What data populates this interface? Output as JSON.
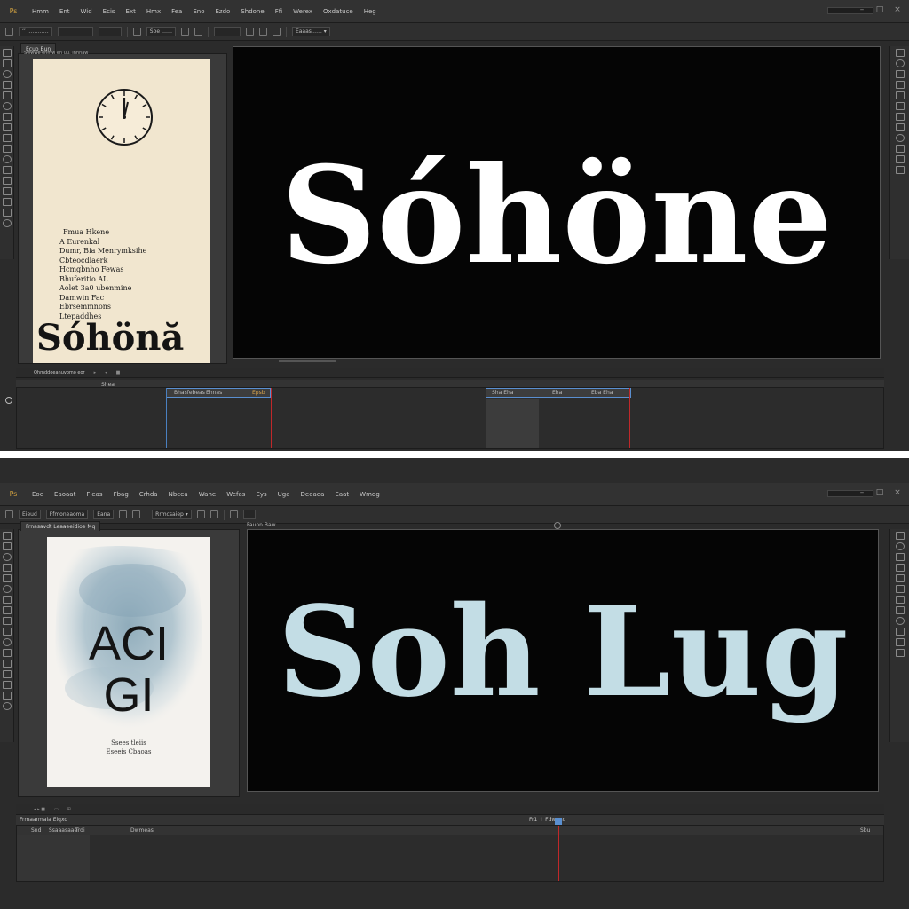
{
  "top": {
    "menu": [
      "Hmm",
      "Ent",
      "Wid",
      "Ecis",
      "Ext",
      "Hmx",
      "Fea",
      "Eno",
      "Ezdo",
      "Shdone",
      "Ffi",
      "Werex",
      "Oxdatuce",
      "Heg"
    ],
    "options": {
      "field1": "‘’ …………",
      "field2": "Sbe ……",
      "dropdown": "Eaaas…… ▾"
    },
    "panel_tab": "Ecuo Bun",
    "panel_subtitle": "Swwwe enmw en uu. Ihhnaw",
    "poster_lines": [
      "Fmua Hkene",
      "A Eurenkal",
      "Dumr, Bia Menrymksihe",
      "Cbteocdlaerk",
      "Hcmgbnho Fewas",
      "Bhuferitio AL",
      "Aolet 3a0 ubenmine",
      "Damwin Fac",
      "Ebrsemmnons",
      "Ltepaddhes"
    ],
    "poster_title": "Sóhönă",
    "viewer_title": "Sóhöne",
    "timeline_tab": "Qhmddoeanuvomo eor",
    "timeline_label": "Shea",
    "clip_labels": [
      "Bhasfebeas",
      "Ehnas",
      "Epsb",
      "Sha Eha",
      "Eha",
      "Eba Eha"
    ]
  },
  "bottom": {
    "menu": [
      "Eoe",
      "Eaoaat",
      "Fleas",
      "Fbag",
      "Crhda",
      "Nbcea",
      "Wane",
      "Wefas",
      "Eys",
      "Uga",
      "Deeaea",
      "Eaat",
      "Wmqg"
    ],
    "options": {
      "field1": "Eieud",
      "field2": "Ffmoneaoma",
      "field3": "Eana",
      "dropdown": "Rrmcsaiep ▾"
    },
    "panel_tab": "Frnasavdt Leaaeeidioe Mq",
    "viewer_tab": "Faunn Baw",
    "poster_title_line1": "ACI",
    "poster_title_line2": "GI",
    "poster_caption_line1": "Ssees tleiis",
    "poster_caption_line2": "Eseeis Cbaoas",
    "viewer_title": "Soh Lug",
    "timeline_tab": "Frmaarmaia Eiqxo",
    "timeline_cols": [
      "Snd",
      "Ssaaasaae",
      "Trdi",
      "Dwmeas"
    ],
    "timeline_right": "Sbu",
    "marker": "Fr1 ↑ Fdwaad"
  },
  "colors": {
    "app_bg": "#2b2b2b",
    "viewer_bg": "#050505",
    "top_title": "#ffffff",
    "bottom_title": "#c3dde5",
    "playhead": "#c0282a",
    "clip_border": "#5a8fd0",
    "poster_cream": "#f1e6cf"
  }
}
